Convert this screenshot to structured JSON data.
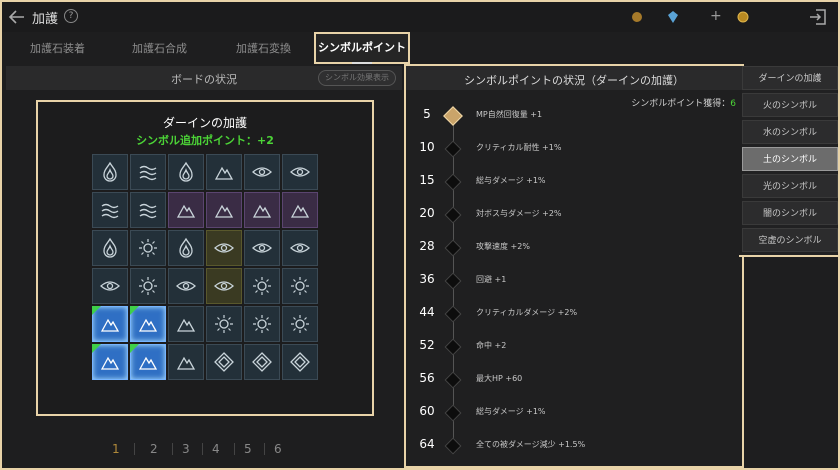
{
  "header": {
    "title": "加護"
  },
  "tabs": [
    {
      "label": "加護石装着"
    },
    {
      "label": "加護石合成"
    },
    {
      "label": "加護石変換"
    },
    {
      "label": "シンボルポイント"
    }
  ],
  "board": {
    "status_title": "ボードの状況",
    "effect_button": "シンボル効果表示",
    "name": "ダーインの加護",
    "bonus_points": "シンボル追加ポイント：+2",
    "pages": [
      "1",
      "2",
      "3",
      "4",
      "5",
      "6"
    ],
    "active_page": "1"
  },
  "detail": {
    "title": "シンボルポイントの状況（ダーインの加護）",
    "earned_label": "シンボルポイント獲得：",
    "earned_value": "6",
    "rows": [
      {
        "level": "5",
        "effect": "MP自然回復量 +1",
        "achieved": true
      },
      {
        "level": "10",
        "effect": "クリティカル耐性 +1%",
        "achieved": false
      },
      {
        "level": "15",
        "effect": "総与ダメージ +1%",
        "achieved": false
      },
      {
        "level": "20",
        "effect": "対ボス与ダメージ +2%",
        "achieved": false
      },
      {
        "level": "28",
        "effect": "攻撃速度 +2%",
        "achieved": false
      },
      {
        "level": "36",
        "effect": "回避 +1",
        "achieved": false
      },
      {
        "level": "44",
        "effect": "クリティカルダメージ +2%",
        "achieved": false
      },
      {
        "level": "52",
        "effect": "命中 +2",
        "achieved": false
      },
      {
        "level": "56",
        "effect": "最大HP +60",
        "achieved": false
      },
      {
        "level": "60",
        "effect": "総与ダメージ +1%",
        "achieved": false
      },
      {
        "level": "64",
        "effect": "全ての被ダメージ減少 +1.5%",
        "achieved": false
      }
    ]
  },
  "sidebar": {
    "items": [
      {
        "label": "ダーインの加護"
      },
      {
        "label": "火のシンボル"
      },
      {
        "label": "水のシンボル"
      },
      {
        "label": "土のシンボル"
      },
      {
        "label": "光のシンボル"
      },
      {
        "label": "闇のシンボル"
      },
      {
        "label": "空虚のシンボル"
      }
    ],
    "active": "土のシンボル"
  },
  "colors": {
    "highlight": "#e8d3a8",
    "green": "#4cd437",
    "active_cell": "#2f6fc4"
  }
}
